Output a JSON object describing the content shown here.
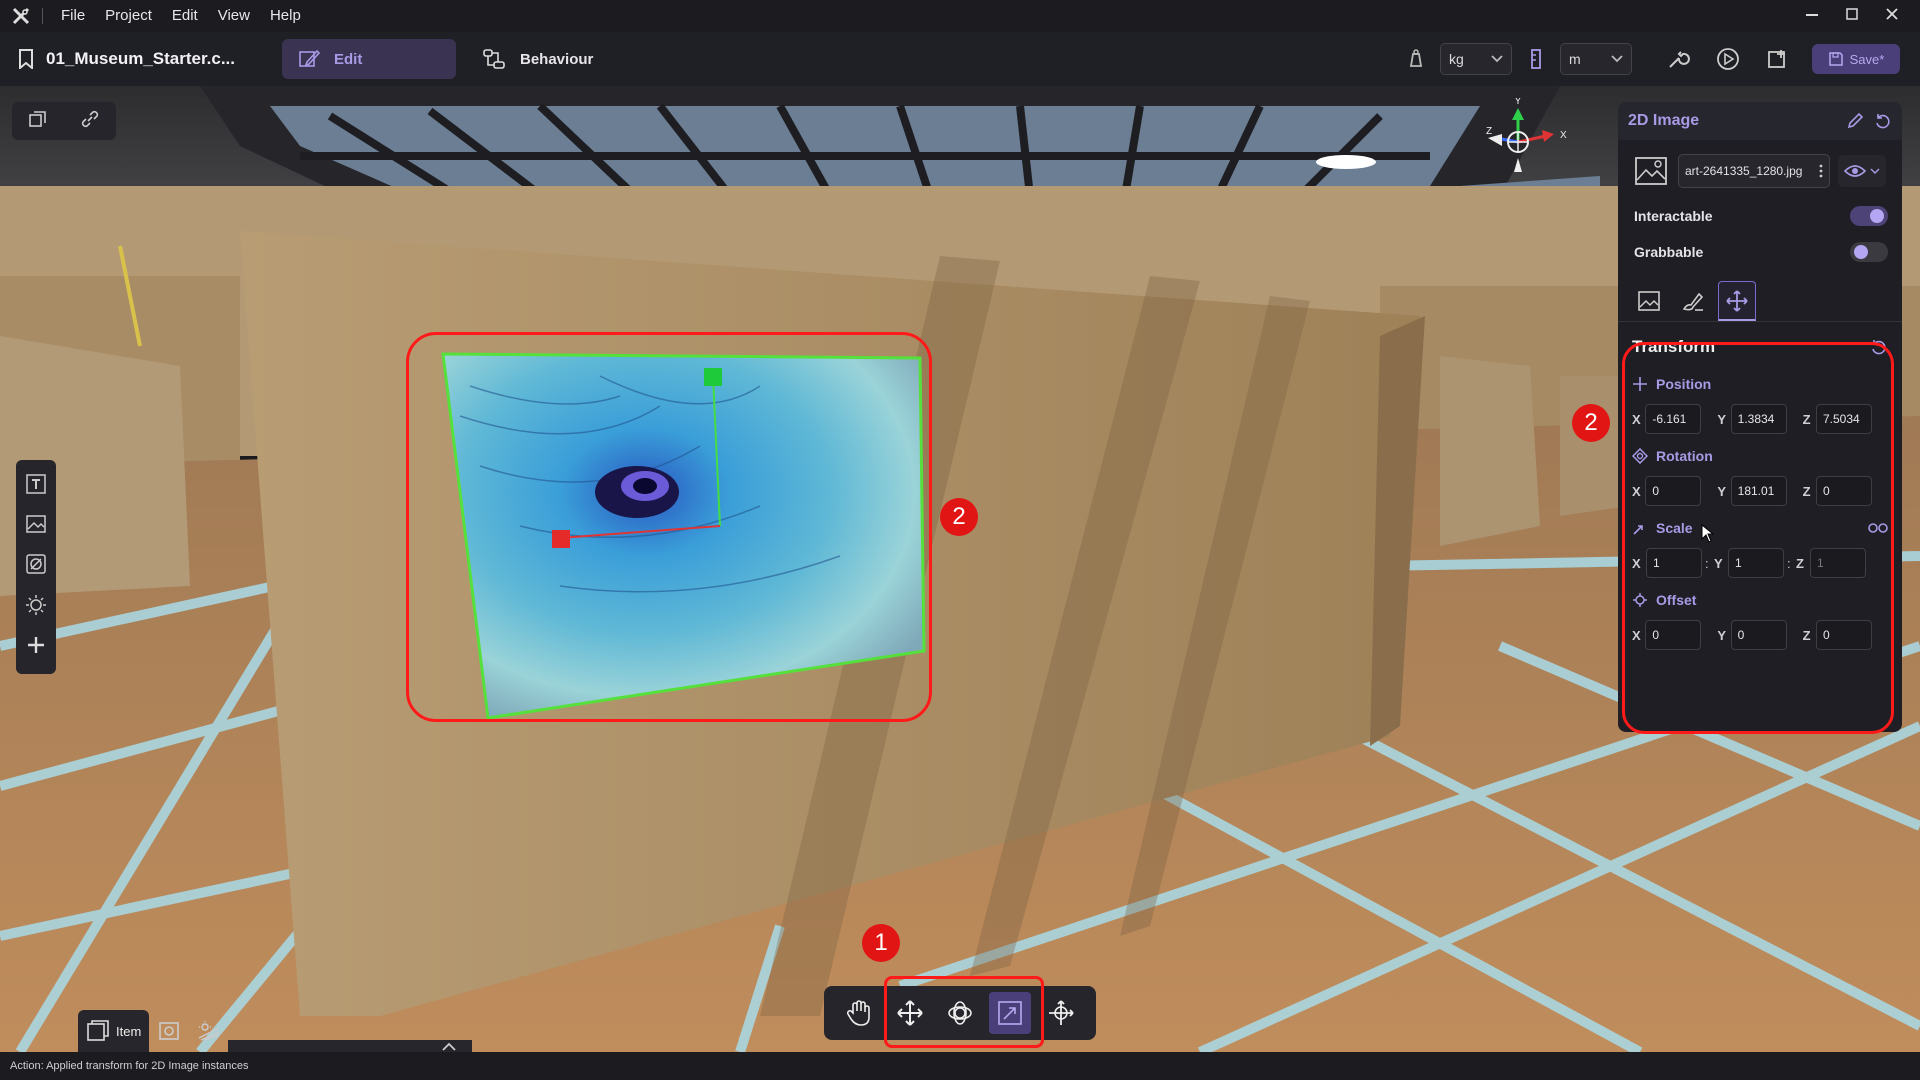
{
  "menu": [
    "File",
    "Project",
    "Edit",
    "View",
    "Help"
  ],
  "toolbar": {
    "project_name": "01_Museum_Starter.c...",
    "tab_edit": "Edit",
    "tab_behaviour": "Behaviour",
    "mass_unit": "kg",
    "length_unit": "m",
    "save_label": "Save*"
  },
  "gizmo_axes": {
    "x": "X",
    "y": "Y",
    "z": "Z"
  },
  "panel": {
    "title": "2D Image",
    "file_name": "art-2641335_1280.jpg",
    "interactable_label": "Interactable",
    "interactable_on": true,
    "grabbable_label": "Grabbable",
    "grabbable_on": false,
    "transform_title": "Transform",
    "position": {
      "label": "Position",
      "x": "-6.161",
      "y": "1.3834",
      "z": "7.5034"
    },
    "rotation": {
      "label": "Rotation",
      "x": "0",
      "y": "181.01",
      "z": "0"
    },
    "scale": {
      "label": "Scale",
      "x": "1",
      "y": "1",
      "z": "1"
    },
    "offset": {
      "label": "Offset",
      "x": "0",
      "y": "0",
      "z": "0"
    }
  },
  "bottom": {
    "item_tab": "Item"
  },
  "annotations": {
    "one": "1",
    "two": "2"
  },
  "status": "Action: Applied transform for 2D Image instances",
  "colors": {
    "accent": "#a99ae6",
    "active_tab": "#3a3352",
    "annotation": "#ff1a1a"
  }
}
